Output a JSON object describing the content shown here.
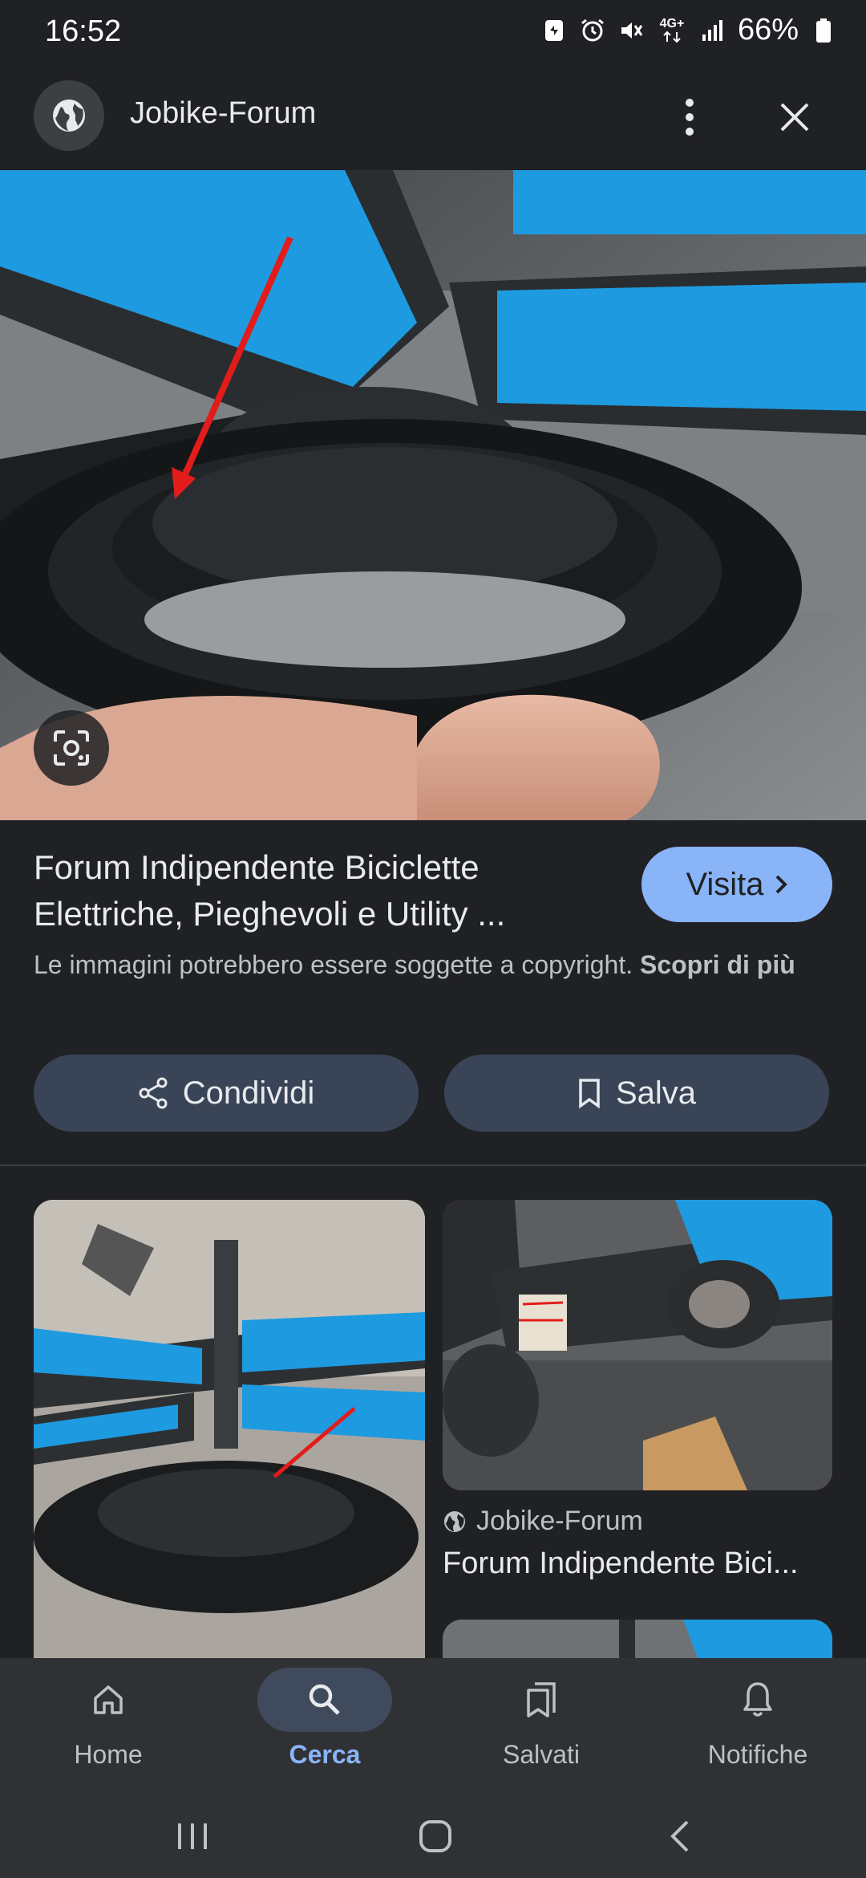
{
  "status_bar": {
    "time": "16:52",
    "network": "4G+",
    "battery": "66%",
    "icons": [
      "notification-icon",
      "alarm-icon",
      "mute-icon",
      "network-icon",
      "signal-icon",
      "battery-icon"
    ]
  },
  "header": {
    "site_name": "Jobike-Forum",
    "icons": [
      "globe-icon",
      "more-vert-icon",
      "close-icon"
    ]
  },
  "result": {
    "title": "Forum Indipendente Biciclette Elettriche, Pieghevoli e Utility ...",
    "visit_label": "Visita",
    "copyright_text": "Le immagini potrebbero essere soggette a copyright.",
    "copyright_link": "Scopri di più",
    "share_label": "Condividi",
    "save_label": "Salva"
  },
  "related": [
    {
      "source": "",
      "title": ""
    },
    {
      "source": "Jobike-Forum",
      "title": "Forum Indipendente Bici..."
    }
  ],
  "bottom_nav": [
    {
      "label": "Home",
      "icon": "home-icon",
      "active": false
    },
    {
      "label": "Cerca",
      "icon": "search-icon",
      "active": true
    },
    {
      "label": "Salvati",
      "icon": "bookmarks-icon",
      "active": false
    },
    {
      "label": "Notifiche",
      "icon": "bell-icon",
      "active": false
    }
  ],
  "colors": {
    "background": "#202124",
    "accent": "#8ab4f8",
    "button_bg": "#394457",
    "nav_bg": "#303134"
  }
}
